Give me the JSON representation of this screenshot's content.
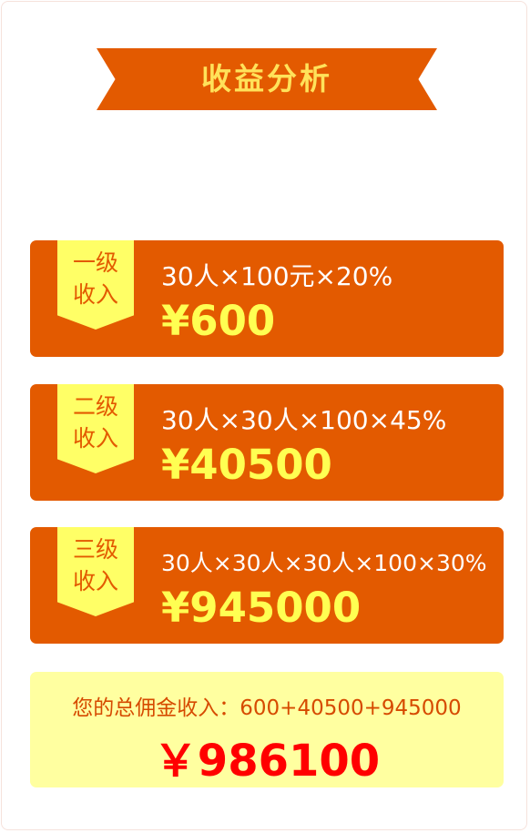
{
  "title": "收益分析",
  "levels": [
    {
      "tag": "一级\n收入",
      "formula": "30人×100元×20%",
      "amount": "¥600"
    },
    {
      "tag": "二级\n收入",
      "formula": "30人×30人×100×45%",
      "amount": "¥40500"
    },
    {
      "tag": "三级\n收入",
      "formula": "30人×30人×30人×100×30%",
      "amount": "¥945000"
    }
  ],
  "summary": {
    "text": "您的总佣金收入：600+40500+945000",
    "total": "￥986100"
  },
  "colors": {
    "accent": "#e35a00",
    "tag": "#ffff66",
    "amount": "#ffff52",
    "summary_bg": "#ffffa0",
    "total": "#ff0000"
  }
}
